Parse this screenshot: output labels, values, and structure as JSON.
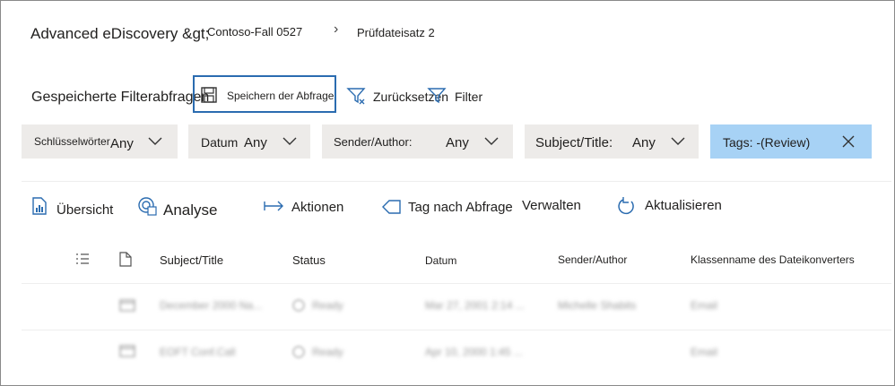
{
  "breadcrumb": {
    "root": "Advanced eDiscovery &gt;",
    "case": "Contoso-Fall 0527",
    "separator": "›",
    "current": "Prüfdateisatz 2"
  },
  "toolbar": {
    "saved_queries_label": "Gespeicherte Filterabfragen",
    "save_query_label": "Speichern der Abfrage",
    "reset_label": "Zurücksetzen",
    "filter_label": "Filter"
  },
  "filters": [
    {
      "label": "Schlüsselwörter",
      "value": "Any"
    },
    {
      "label": "Datum",
      "value": "Any"
    },
    {
      "label": "Sender/Author:",
      "value": "Any"
    },
    {
      "label": "Subject/Title:",
      "value": "Any"
    },
    {
      "label": "Tags: -(Review)"
    }
  ],
  "commands": {
    "overview": "Übersicht",
    "analysis": "Analyse",
    "actions": "Aktionen",
    "tag_by_query": "Tag nach Abfrage",
    "manage": "Verwalten",
    "refresh": "Aktualisieren"
  },
  "columns": {
    "subject": "Subject/Title",
    "status": "Status",
    "date": "Datum",
    "sender": "Sender/Author",
    "class": "Klassenname des Dateikonverters"
  },
  "rows": [
    {
      "subject": "December 2000 Na...",
      "status": "Ready",
      "date": "Mar 27, 2001 2:14 ...",
      "sender": "Michelle Shabits",
      "class": "Email"
    },
    {
      "subject": "EOFT Conf.Call",
      "status": "Ready",
      "date": "Apr 10, 2000 1:45 ...",
      "sender": "",
      "class": "Email"
    }
  ],
  "colors": {
    "accent": "#2b6cb0",
    "pill": "#edebe9",
    "tags_pill": "#a7d2f5"
  }
}
